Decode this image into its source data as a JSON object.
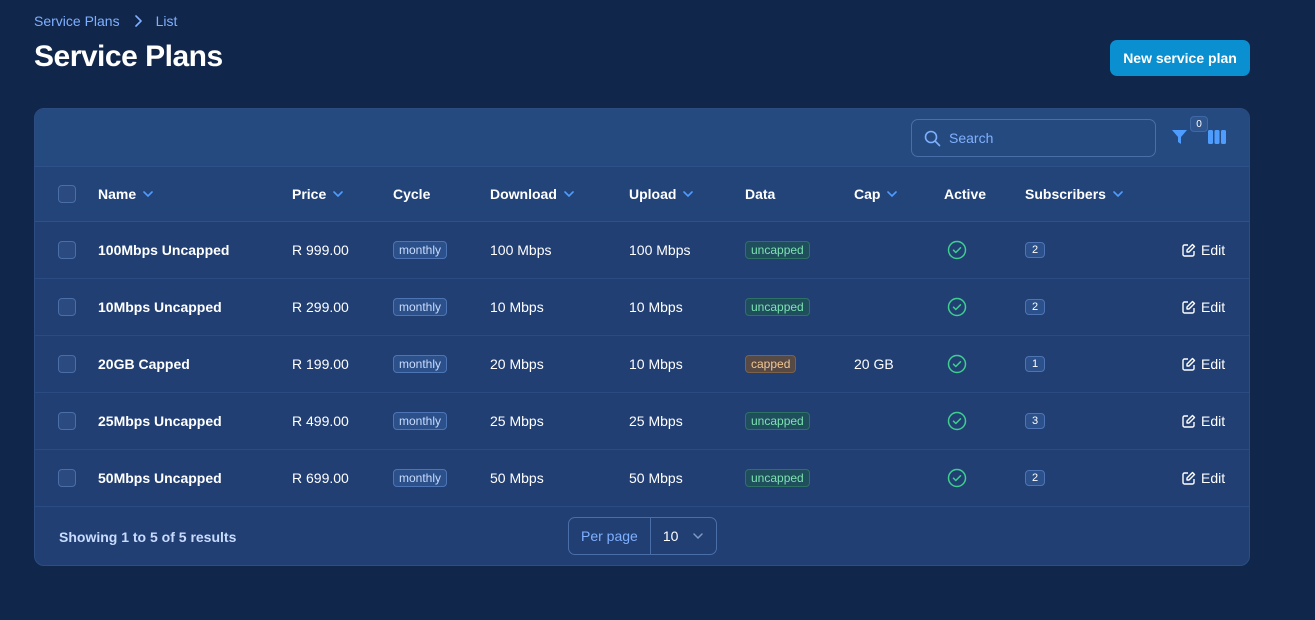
{
  "breadcrumb": {
    "parent": "Service Plans",
    "current": "List"
  },
  "page_title": "Service Plans",
  "new_button_label": "New service plan",
  "search": {
    "placeholder": "Search"
  },
  "filter_count": "0",
  "columns": {
    "name": "Name",
    "price": "Price",
    "cycle": "Cycle",
    "download": "Download",
    "upload": "Upload",
    "data": "Data",
    "cap": "Cap",
    "active": "Active",
    "subscribers": "Subscribers"
  },
  "rows": [
    {
      "name": "100Mbps Uncapped",
      "price": "R 999.00",
      "cycle": "monthly",
      "download": "100 Mbps",
      "upload": "100 Mbps",
      "data": "uncapped",
      "cap": "",
      "active": true,
      "subscribers": "2",
      "edit": "Edit"
    },
    {
      "name": "10Mbps Uncapped",
      "price": "R 299.00",
      "cycle": "monthly",
      "download": "10 Mbps",
      "upload": "10 Mbps",
      "data": "uncapped",
      "cap": "",
      "active": true,
      "subscribers": "2",
      "edit": "Edit"
    },
    {
      "name": "20GB Capped",
      "price": "R 199.00",
      "cycle": "monthly",
      "download": "20 Mbps",
      "upload": "10 Mbps",
      "data": "capped",
      "cap": "20 GB",
      "active": true,
      "subscribers": "1",
      "edit": "Edit"
    },
    {
      "name": "25Mbps Uncapped",
      "price": "R 499.00",
      "cycle": "monthly",
      "download": "25 Mbps",
      "upload": "25 Mbps",
      "data": "uncapped",
      "cap": "",
      "active": true,
      "subscribers": "3",
      "edit": "Edit"
    },
    {
      "name": "50Mbps Uncapped",
      "price": "R 699.00",
      "cycle": "monthly",
      "download": "50 Mbps",
      "upload": "50 Mbps",
      "data": "uncapped",
      "cap": "",
      "active": true,
      "subscribers": "2",
      "edit": "Edit"
    }
  ],
  "footer": {
    "showing": "Showing 1 to 5 of 5 results",
    "per_page_label": "Per page",
    "per_page_value": "10"
  },
  "colors": {
    "background": "#10264b",
    "card": "#213f73",
    "accent": "#0a8fd0",
    "link": "#7fb0ff",
    "active_check": "#3ecf8e"
  }
}
